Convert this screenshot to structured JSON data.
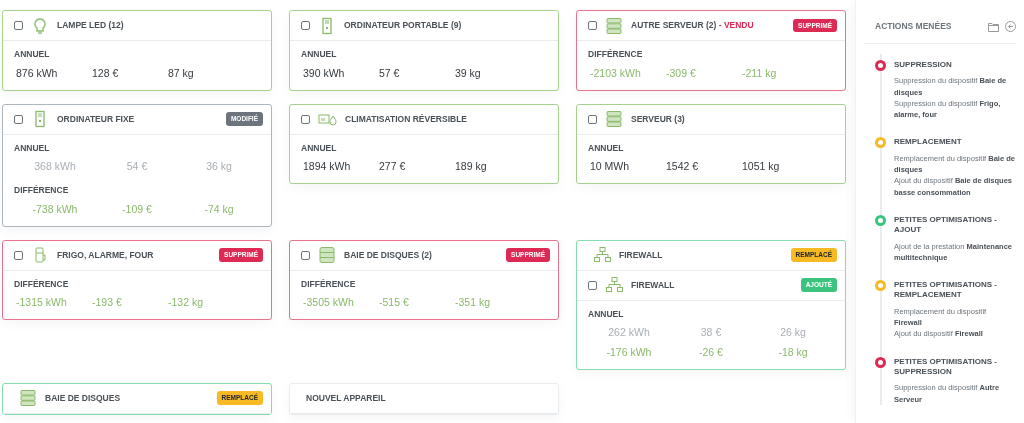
{
  "cards": [
    {
      "kind": "active",
      "headers": [
        {
          "checked": false,
          "kind": "bulb",
          "title": "LAMPE LED (12)"
        }
      ],
      "sections": [
        {
          "label": "ANNUEL",
          "rows": [
            {
              "kind": "normal",
              "values": [
                "876 kWh",
                "128 €",
                "87 kg"
              ]
            }
          ]
        }
      ]
    },
    {
      "kind": "active",
      "headers": [
        {
          "checked": false,
          "kind": "computer",
          "title": "ORDINATEUR PORTABLE (9)"
        }
      ],
      "sections": [
        {
          "label": "ANNUEL",
          "rows": [
            {
              "kind": "normal",
              "values": [
                "390 kWh",
                "57 €",
                "39 kg"
              ]
            }
          ]
        }
      ]
    },
    {
      "kind": "deleted",
      "headers": [
        {
          "checked": false,
          "kind": "server",
          "title": "AUTRE SERVEUR (2)",
          "suffix": "- VENDU",
          "badge": {
            "kind": "deleted",
            "label": "SUPPRIMÉ"
          }
        }
      ],
      "sections": [
        {
          "label": "DIFFÉRENCE",
          "rows": [
            {
              "kind": "gain",
              "values": [
                "-2103 kWh",
                "-309 €",
                "-211 kg"
              ]
            }
          ]
        }
      ]
    },
    {
      "kind": "modified",
      "headers": [
        {
          "checked": false,
          "kind": "computer",
          "title": "ORDINATEUR FIXE",
          "badge": {
            "kind": "modified",
            "label": "MODIFIÉ"
          }
        }
      ],
      "sections": [
        {
          "label": "ANNUEL",
          "rows": [
            {
              "kind": "muted",
              "values": [
                "368 kWh",
                "54 €",
                "36 kg"
              ]
            }
          ]
        },
        {
          "label": "DIFFÉRENCE",
          "rows": [
            {
              "kind": "gain",
              "values": [
                "-738 kWh",
                "-109 €",
                "-74 kg"
              ]
            }
          ]
        }
      ]
    },
    {
      "kind": "active",
      "headers": [
        {
          "checked": false,
          "kind": "ac",
          "title": "CLIMATISATION RÉVERSIBLE"
        }
      ],
      "sections": [
        {
          "label": "ANNUEL",
          "rows": [
            {
              "kind": "normal",
              "values": [
                "1894 kWh",
                "277 €",
                "189 kg"
              ]
            }
          ]
        }
      ]
    },
    {
      "kind": "active",
      "headers": [
        {
          "checked": false,
          "kind": "server",
          "title": "SERVEUR (3)"
        }
      ],
      "sections": [
        {
          "label": "ANNUEL",
          "rows": [
            {
              "kind": "normal",
              "values": [
                "10 MWh",
                "1542 €",
                "1051 kg"
              ]
            }
          ]
        }
      ]
    },
    {
      "kind": "deleted",
      "headers": [
        {
          "checked": false,
          "kind": "fridge",
          "title": "FRIGO, ALARME, FOUR",
          "badge": {
            "kind": "deleted",
            "label": "SUPPRIMÉ"
          }
        }
      ],
      "sections": [
        {
          "label": "DIFFÉRENCE",
          "rows": [
            {
              "kind": "gain",
              "values": [
                "-1315 kWh",
                "-193 €",
                "-132 kg"
              ]
            }
          ]
        }
      ]
    },
    {
      "kind": "deleted",
      "headers": [
        {
          "checked": false,
          "kind": "disks",
          "title": "BAIE DE DISQUES (2)",
          "badge": {
            "kind": "deleted",
            "label": "SUPPRIMÉ"
          }
        }
      ],
      "sections": [
        {
          "label": "DIFFÉRENCE",
          "rows": [
            {
              "kind": "gain",
              "values": [
                "-3505 kWh",
                "-515 €",
                "-351 kg"
              ]
            }
          ]
        }
      ]
    },
    {
      "kind": "replaced",
      "headers": [
        {
          "kind": "network",
          "title": "FIREWALL",
          "badge": {
            "kind": "replaced",
            "label": "REMPLACÉ"
          }
        },
        {
          "checked": false,
          "kind": "network",
          "title": "FIREWALL",
          "badge": {
            "kind": "added",
            "label": "AJOUTÉ"
          }
        }
      ],
      "sections": [
        {
          "label": "ANNUEL",
          "rows": [
            {
              "kind": "muted",
              "values": [
                "262 kWh",
                "38 €",
                "26 kg"
              ]
            },
            {
              "kind": "gain",
              "values": [
                "-176 kWh",
                "-26 €",
                "-18 kg"
              ]
            }
          ]
        }
      ]
    },
    {
      "kind": "replaced",
      "headers": [
        {
          "kind": "server",
          "title": "BAIE DE DISQUES",
          "badge": {
            "kind": "replaced",
            "label": "REMPLACÉ"
          }
        }
      ]
    },
    {
      "kind": "plain",
      "headers": [
        {
          "title": "NOUVEL APPAREIL"
        }
      ]
    }
  ],
  "sidebar": {
    "title": "ACTIONS MENÉES",
    "items": [
      {
        "color": "#dc2a54",
        "title": "SUPPRESSION",
        "lines": [
          "Suppression du dispositif **Baie de disques**",
          "Suppression du dispositif **Frigo, alarme, four**"
        ]
      },
      {
        "color": "#f7b924",
        "title": "REMPLACEMENT",
        "lines": [
          "Remplacement du dispositif **Baie de disques**",
          "Ajout du dispositif **Baie de disques basse consommation**"
        ]
      },
      {
        "color": "#3ac47d",
        "title": "PETITES OPTIMISATIONS - AJOUT",
        "lines": [
          "Ajout de la prestation **Maintenance multitechnique**"
        ]
      },
      {
        "color": "#f7b924",
        "title": "PETITES OPTIMISATIONS - REMPLACEMENT",
        "lines": [
          "Remplacement du dispositif **Firewall**",
          "Ajout du dispositif **Firewall**"
        ]
      },
      {
        "color": "#dc2a54",
        "title": "PETITES OPTIMISATIONS - SUPPRESSION",
        "lines": [
          "Suppression du dispositif **Autre Serveur**"
        ]
      }
    ]
  }
}
